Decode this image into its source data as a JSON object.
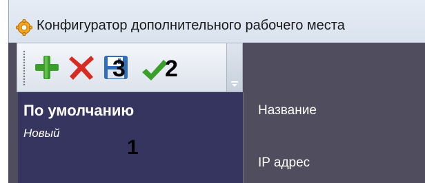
{
  "window": {
    "title": "Конфигуратор дополнительного рабочего места",
    "app_icon": "gear-icon"
  },
  "toolbar": {
    "buttons": [
      {
        "name": "add",
        "icon": "plus-icon",
        "color": "#3aa02a"
      },
      {
        "name": "delete",
        "icon": "cross-icon",
        "color": "#d82c22"
      },
      {
        "name": "save",
        "icon": "floppy-disk-icon"
      },
      {
        "name": "apply",
        "icon": "checkmark-icon",
        "color": "#3aa02a"
      }
    ],
    "overflow_icon": "chevron-down-icon"
  },
  "markers": {
    "list": "1",
    "apply": "2",
    "save": "3"
  },
  "list": {
    "items": [
      {
        "title": "По умолчанию",
        "subtitle": "Новый"
      }
    ]
  },
  "details": {
    "name_label": "Название",
    "ip_label": "IP адрес"
  },
  "colors": {
    "window_bg": "#4f4d5e",
    "list_bg": "#363560",
    "titlebar_bg": "#dfe6f0"
  }
}
